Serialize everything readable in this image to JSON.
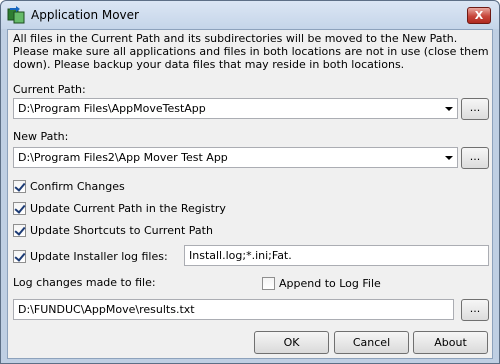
{
  "window": {
    "title": "Application Mover",
    "close_glyph": "X"
  },
  "info_text": "All files in the Current Path and its subdirectories will be moved to the New Path.  Please make sure all applications and files in both locations are not in use (close them down).  Please backup your data files that may reside in both locations.",
  "current_path": {
    "label": "Current Path:",
    "value": "D:\\Program Files\\AppMoveTestApp",
    "browse_label": "..."
  },
  "new_path": {
    "label": "New Path:",
    "value": "D:\\Program Files2\\App Mover Test App",
    "browse_label": "..."
  },
  "options": {
    "confirm_changes": {
      "label": "Confirm Changes",
      "checked": true
    },
    "update_registry": {
      "label": "Update Current Path in the Registry",
      "checked": true
    },
    "update_shortcuts": {
      "label": "Update Shortcuts to Current Path",
      "checked": true
    },
    "update_installer": {
      "label": "Update Installer log files:",
      "checked": true,
      "value": "Install.log;*.ini;Fat."
    }
  },
  "log": {
    "label": "Log changes made to file:",
    "append_label": "Append to Log File",
    "append_checked": false,
    "value": "D:\\FUNDUC\\AppMove\\results.txt",
    "browse_label": "..."
  },
  "buttons": {
    "ok": "OK",
    "cancel": "Cancel",
    "about": "About"
  },
  "colors": {
    "frame": "#bfcfe3",
    "client": "#f0f0f0",
    "close": "#c7453a"
  }
}
